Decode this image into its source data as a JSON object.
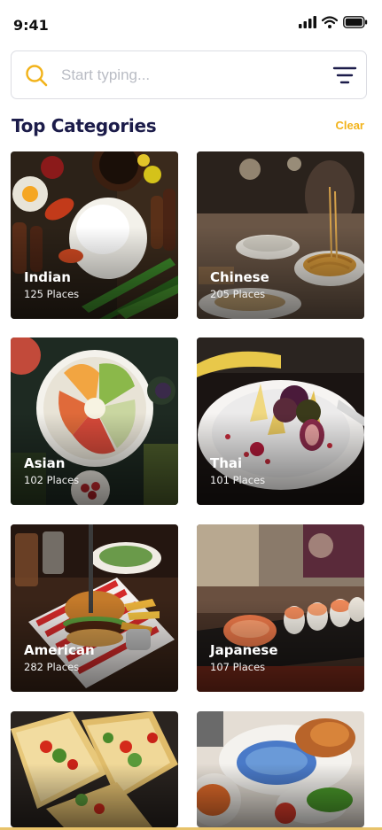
{
  "status": {
    "time": "9:41"
  },
  "search": {
    "placeholder": "Start typing..."
  },
  "header": {
    "title": "Top Categories",
    "clear_label": "Clear"
  },
  "categories": [
    {
      "name": "Indian",
      "places": "125 Places"
    },
    {
      "name": "Chinese",
      "places": "205 Places"
    },
    {
      "name": "Asian",
      "places": "102 Places"
    },
    {
      "name": "Thai",
      "places": "101 Places"
    },
    {
      "name": "American",
      "places": "282 Places"
    },
    {
      "name": "Japanese",
      "places": "107 Places"
    },
    {
      "name": "",
      "places": ""
    },
    {
      "name": "",
      "places": ""
    }
  ],
  "colors": {
    "accent": "#f2b31a",
    "title": "#1c1c4a"
  }
}
